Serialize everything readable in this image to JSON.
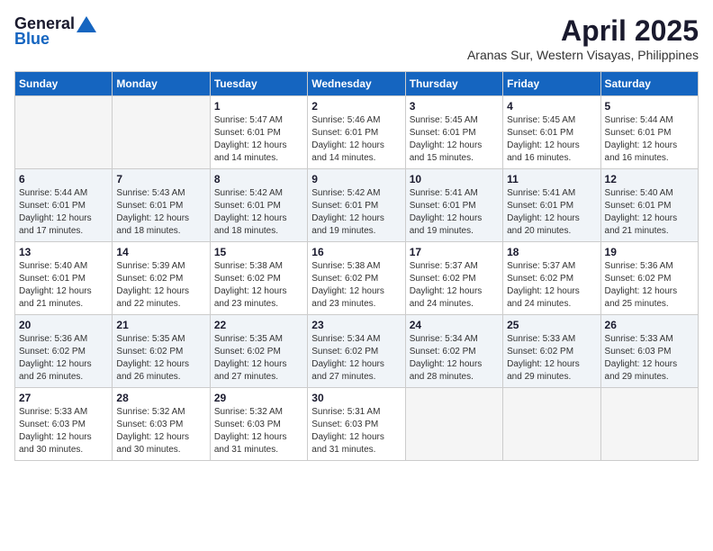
{
  "header": {
    "logo_general": "General",
    "logo_blue": "Blue",
    "month_title": "April 2025",
    "subtitle": "Aranas Sur, Western Visayas, Philippines"
  },
  "weekdays": [
    "Sunday",
    "Monday",
    "Tuesday",
    "Wednesday",
    "Thursday",
    "Friday",
    "Saturday"
  ],
  "weeks": [
    [
      {
        "day": "",
        "info": ""
      },
      {
        "day": "",
        "info": ""
      },
      {
        "day": "1",
        "info": "Sunrise: 5:47 AM\nSunset: 6:01 PM\nDaylight: 12 hours\nand 14 minutes."
      },
      {
        "day": "2",
        "info": "Sunrise: 5:46 AM\nSunset: 6:01 PM\nDaylight: 12 hours\nand 14 minutes."
      },
      {
        "day": "3",
        "info": "Sunrise: 5:45 AM\nSunset: 6:01 PM\nDaylight: 12 hours\nand 15 minutes."
      },
      {
        "day": "4",
        "info": "Sunrise: 5:45 AM\nSunset: 6:01 PM\nDaylight: 12 hours\nand 16 minutes."
      },
      {
        "day": "5",
        "info": "Sunrise: 5:44 AM\nSunset: 6:01 PM\nDaylight: 12 hours\nand 16 minutes."
      }
    ],
    [
      {
        "day": "6",
        "info": "Sunrise: 5:44 AM\nSunset: 6:01 PM\nDaylight: 12 hours\nand 17 minutes."
      },
      {
        "day": "7",
        "info": "Sunrise: 5:43 AM\nSunset: 6:01 PM\nDaylight: 12 hours\nand 18 minutes."
      },
      {
        "day": "8",
        "info": "Sunrise: 5:42 AM\nSunset: 6:01 PM\nDaylight: 12 hours\nand 18 minutes."
      },
      {
        "day": "9",
        "info": "Sunrise: 5:42 AM\nSunset: 6:01 PM\nDaylight: 12 hours\nand 19 minutes."
      },
      {
        "day": "10",
        "info": "Sunrise: 5:41 AM\nSunset: 6:01 PM\nDaylight: 12 hours\nand 19 minutes."
      },
      {
        "day": "11",
        "info": "Sunrise: 5:41 AM\nSunset: 6:01 PM\nDaylight: 12 hours\nand 20 minutes."
      },
      {
        "day": "12",
        "info": "Sunrise: 5:40 AM\nSunset: 6:01 PM\nDaylight: 12 hours\nand 21 minutes."
      }
    ],
    [
      {
        "day": "13",
        "info": "Sunrise: 5:40 AM\nSunset: 6:01 PM\nDaylight: 12 hours\nand 21 minutes."
      },
      {
        "day": "14",
        "info": "Sunrise: 5:39 AM\nSunset: 6:02 PM\nDaylight: 12 hours\nand 22 minutes."
      },
      {
        "day": "15",
        "info": "Sunrise: 5:38 AM\nSunset: 6:02 PM\nDaylight: 12 hours\nand 23 minutes."
      },
      {
        "day": "16",
        "info": "Sunrise: 5:38 AM\nSunset: 6:02 PM\nDaylight: 12 hours\nand 23 minutes."
      },
      {
        "day": "17",
        "info": "Sunrise: 5:37 AM\nSunset: 6:02 PM\nDaylight: 12 hours\nand 24 minutes."
      },
      {
        "day": "18",
        "info": "Sunrise: 5:37 AM\nSunset: 6:02 PM\nDaylight: 12 hours\nand 24 minutes."
      },
      {
        "day": "19",
        "info": "Sunrise: 5:36 AM\nSunset: 6:02 PM\nDaylight: 12 hours\nand 25 minutes."
      }
    ],
    [
      {
        "day": "20",
        "info": "Sunrise: 5:36 AM\nSunset: 6:02 PM\nDaylight: 12 hours\nand 26 minutes."
      },
      {
        "day": "21",
        "info": "Sunrise: 5:35 AM\nSunset: 6:02 PM\nDaylight: 12 hours\nand 26 minutes."
      },
      {
        "day": "22",
        "info": "Sunrise: 5:35 AM\nSunset: 6:02 PM\nDaylight: 12 hours\nand 27 minutes."
      },
      {
        "day": "23",
        "info": "Sunrise: 5:34 AM\nSunset: 6:02 PM\nDaylight: 12 hours\nand 27 minutes."
      },
      {
        "day": "24",
        "info": "Sunrise: 5:34 AM\nSunset: 6:02 PM\nDaylight: 12 hours\nand 28 minutes."
      },
      {
        "day": "25",
        "info": "Sunrise: 5:33 AM\nSunset: 6:02 PM\nDaylight: 12 hours\nand 29 minutes."
      },
      {
        "day": "26",
        "info": "Sunrise: 5:33 AM\nSunset: 6:03 PM\nDaylight: 12 hours\nand 29 minutes."
      }
    ],
    [
      {
        "day": "27",
        "info": "Sunrise: 5:33 AM\nSunset: 6:03 PM\nDaylight: 12 hours\nand 30 minutes."
      },
      {
        "day": "28",
        "info": "Sunrise: 5:32 AM\nSunset: 6:03 PM\nDaylight: 12 hours\nand 30 minutes."
      },
      {
        "day": "29",
        "info": "Sunrise: 5:32 AM\nSunset: 6:03 PM\nDaylight: 12 hours\nand 31 minutes."
      },
      {
        "day": "30",
        "info": "Sunrise: 5:31 AM\nSunset: 6:03 PM\nDaylight: 12 hours\nand 31 minutes."
      },
      {
        "day": "",
        "info": ""
      },
      {
        "day": "",
        "info": ""
      },
      {
        "day": "",
        "info": ""
      }
    ]
  ]
}
